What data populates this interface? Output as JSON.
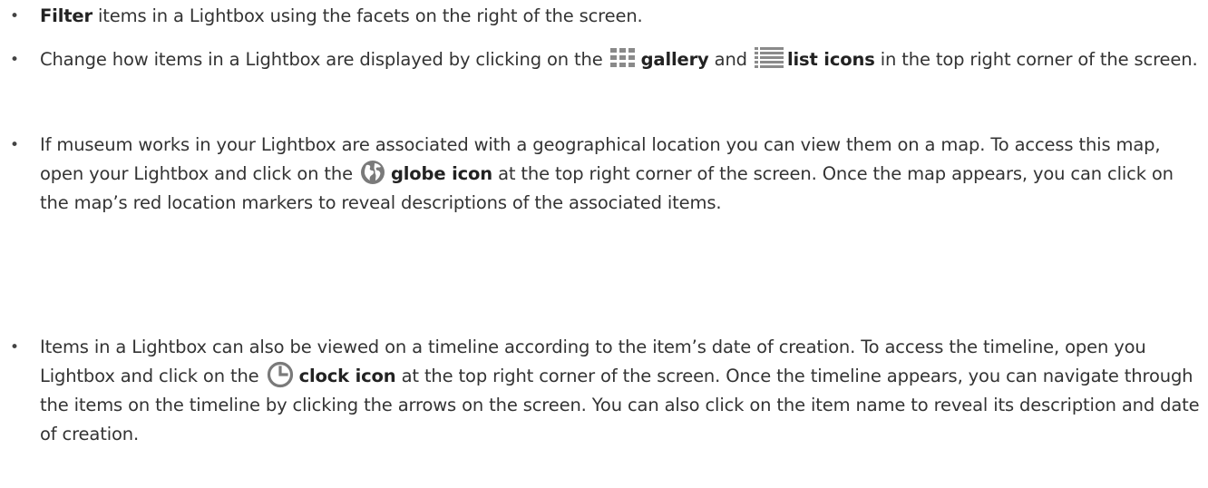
{
  "items": [
    {
      "bold": "Filter",
      "text": " items in a Lightbox using the facets on the right of the screen."
    },
    {
      "pre": "Change how items in a Lightbox are displayed by clicking on the ",
      "gallery_label": "gallery",
      "mid": " and ",
      "list_label": "list icons",
      "post": " in the top right corner of the screen."
    },
    {
      "pre": "If museum works in your Lightbox are associated with a geographical location you can view them on a map. To access this map, open your Lightbox and click on the ",
      "icon_label": "globe icon",
      "post": " at the top right corner of the screen. Once the map appears, you can click on the map’s red location markers to reveal descriptions of the associated items."
    },
    {
      "pre": "Items in a Lightbox can also be viewed on a timeline according to the item’s date of creation. To access the timeline, open you Lightbox and click on the ",
      "icon_label": "clock icon",
      "post": " at the top right corner of the screen. Once the timeline appears, you can navigate through the items on the timeline by clicking the arrows on the screen. You can also click on the item name to reveal its description and date of creation."
    }
  ],
  "bullet_char": "•",
  "icons": {
    "gallery": "grid-icon",
    "list": "list-icon",
    "globe": "globe-icon",
    "clock": "clock-icon"
  },
  "colors": {
    "text": "#333333",
    "icon_gray": "#8a8a8a",
    "globe_gray": "#7a7a7a"
  }
}
